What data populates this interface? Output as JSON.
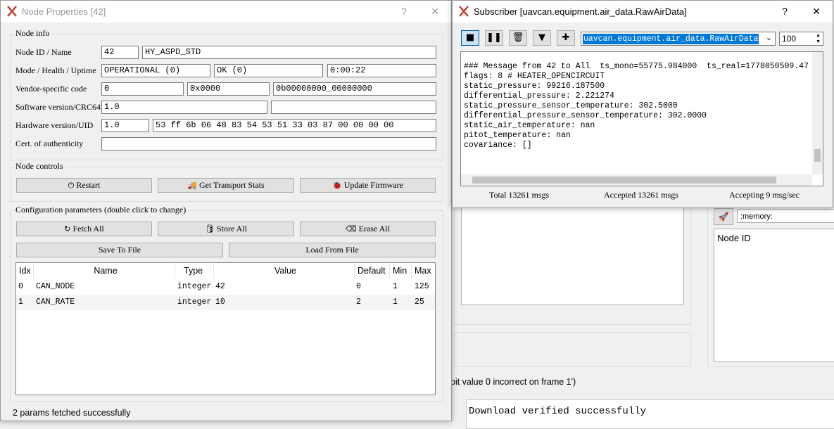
{
  "background": {
    "memory_input": ":memory:",
    "node_id_header": "Node ID",
    "log_partial": "bit value 0 incorrect on frame 1')",
    "console_text": "Download verified successfully"
  },
  "node_props": {
    "title": "Node Properties [42]",
    "help": "?",
    "close": "✕",
    "node_info_label": "Node info",
    "labels": {
      "id_name": "Node ID / Name",
      "mode": "Mode / Health / Uptime",
      "vendor": "Vendor-specific code",
      "software": "Software version/CRC64",
      "hardware": "Hardware version/UID",
      "cert": "Cert. of authenticity"
    },
    "values": {
      "node_id": "42",
      "name": "HY_ASPD_STD",
      "mode": "OPERATIONAL (0)",
      "health": "OK (0)",
      "uptime": "0:00:22",
      "vendor_dec": "0",
      "vendor_hex": "0x0000",
      "vendor_bin": "0b00000000_00000000",
      "sw_version": "1.0",
      "sw_crc": "",
      "hw_version": "1.0",
      "hw_uid": "53 ff 6b 06 48 83 54 53 51 33 03 87 00 00 00 00",
      "cert": ""
    },
    "controls_label": "Node controls",
    "buttons": {
      "restart": "Restart",
      "transport": "Get Transport Stats",
      "firmware": "Update Firmware",
      "fetch": "Fetch All",
      "store": "Store All",
      "erase": "Erase All",
      "save": "Save To File",
      "load": "Load From File"
    },
    "config_label": "Configuration parameters (double click to change)",
    "table": {
      "headers": [
        "Idx",
        "Name",
        "Type",
        "Value",
        "Default",
        "Min",
        "Max"
      ],
      "rows": [
        [
          "0",
          "CAN_NODE",
          "integer",
          "42",
          "0",
          "1",
          "125"
        ],
        [
          "1",
          "CAN_RATE",
          "integer",
          "10",
          "2",
          "1",
          "25"
        ]
      ]
    },
    "status": "2 params fetched successfully"
  },
  "subscriber": {
    "title": "Subscriber [uavcan.equipment.air_data.RawAirData]",
    "help": "?",
    "close": "✕",
    "type_select": "uavcan.equipment.air_data.RawAirData",
    "count": "100",
    "message_lines": [
      "### Message from 42 to All  ts_mono=55775.984000  ts_real=1778050509.47",
      "flags: 8 # HEATER_OPENCIRCUIT",
      "static_pressure: 99216.187500",
      "differential_pressure: 2.221274",
      "static_pressure_sensor_temperature: 302.5000",
      "differential_pressure_sensor_temperature: 302.0000",
      "static_air_temperature: nan",
      "pitot_temperature: nan",
      "covariance: []"
    ],
    "stats": {
      "total": "Total  13261  msgs",
      "accepted": "Accepted  13261  msgs",
      "rate": "Accepting  9  msg/sec"
    }
  },
  "colors": {
    "accent": "#0078d7",
    "selection": "#0078d7",
    "logo": "#c0392b"
  }
}
